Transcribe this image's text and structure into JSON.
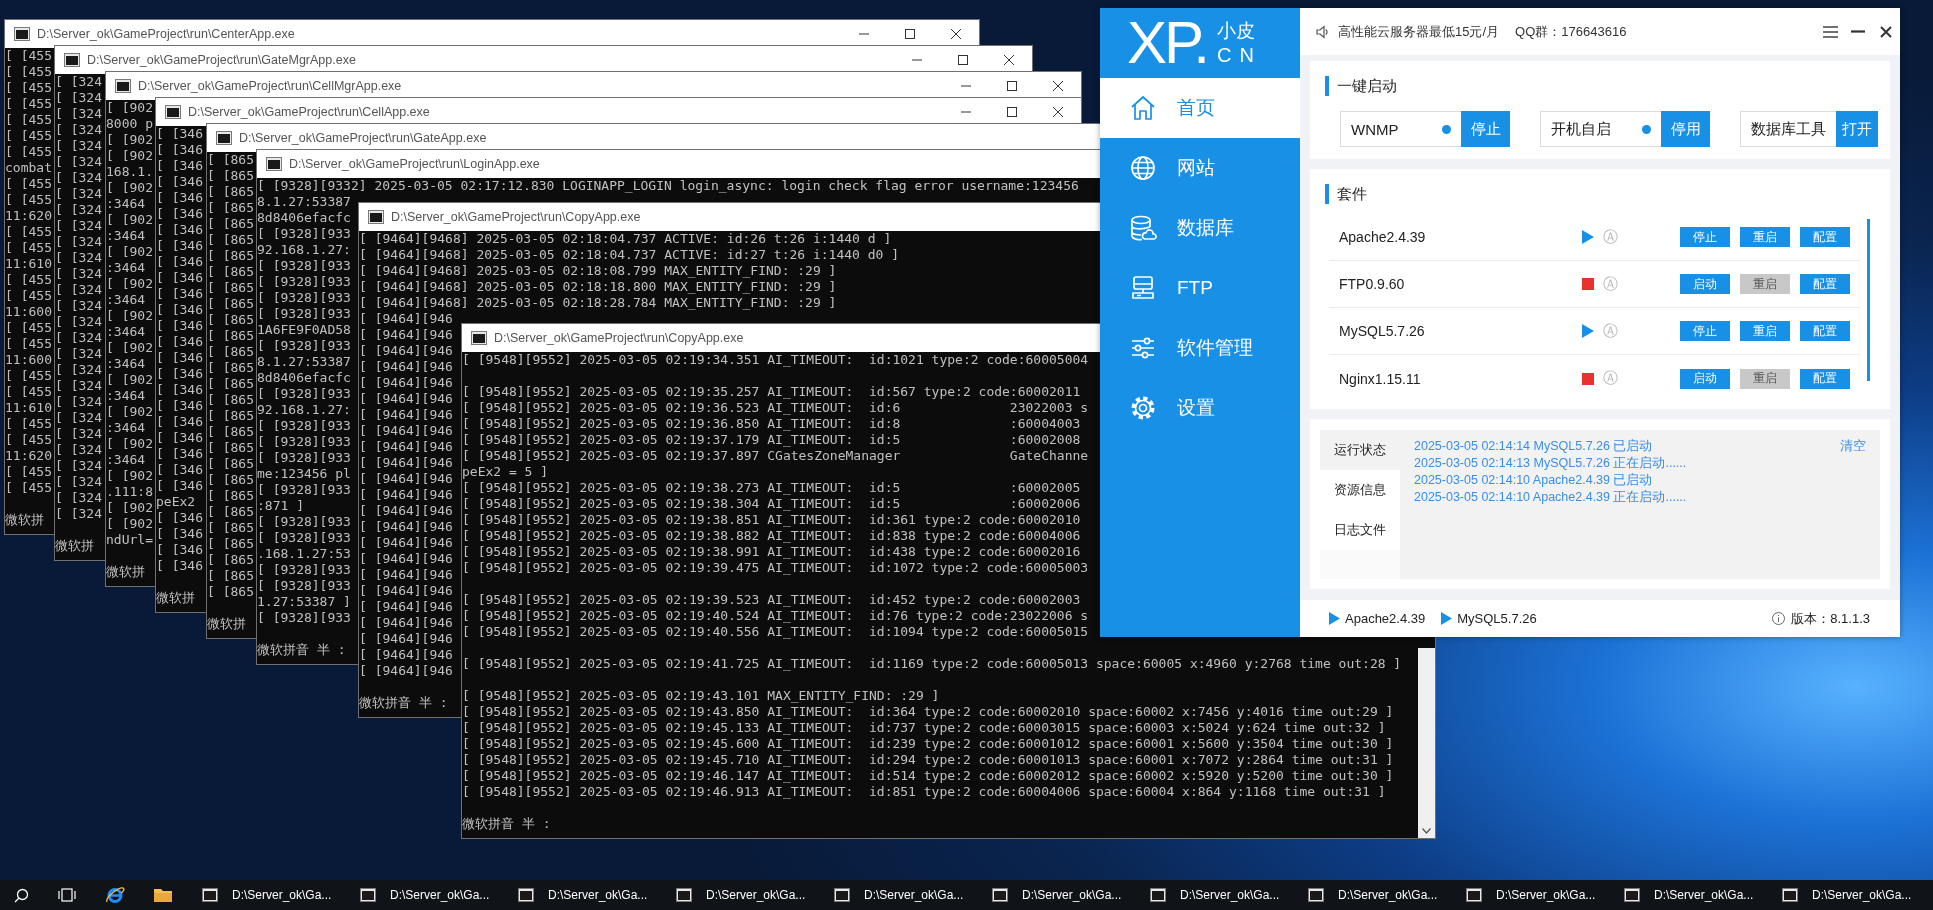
{
  "console_windows": [
    {
      "title": "D:\\Server_ok\\GameProject\\run\\CenterApp.exe",
      "controls": true,
      "blocks": [
        [
          "[ [455",
          "[ [455",
          "[ [455",
          "[ [455",
          "[ [455",
          "[ [455",
          "[ [455",
          "combat",
          "[ [455",
          "[ [455",
          "11:620",
          "[ [455",
          "[ [455",
          "11:610",
          "[ [455",
          "[ [455",
          "11:600",
          "[ [455",
          "[ [455",
          "11:600",
          "[ [455",
          "[ [455",
          "11:610",
          "[ [455",
          "[ [455",
          "11:620",
          "[ [455",
          "[ [455"
        ]
      ],
      "ime_status": "微软拼"
    },
    {
      "title": "D:\\Server_ok\\GameProject\\run\\GateMgrApp.exe",
      "controls": true,
      "blocks": [
        [
          "[ [324",
          "[ [324",
          "[ [324",
          "[ [324",
          "[ [324",
          "[ [324",
          "[ [324",
          "[ [324",
          "[ [324",
          "[ [324",
          "[ [324",
          "[ [324",
          "[ [324",
          "[ [324",
          "[ [324",
          "[ [324",
          "[ [324",
          "[ [324",
          "[ [324",
          "[ [324",
          "[ [324",
          "[ [324",
          "[ [324",
          "[ [324",
          "[ [324",
          "[ [324",
          "[ [324",
          "[ [324"
        ]
      ],
      "ime_status": "微软拼"
    },
    {
      "title": "D:\\Server_ok\\GameProject\\run\\CellMgrApp.exe",
      "controls": true,
      "blocks": [
        [
          "[ [902",
          "8000 p",
          "[ [902",
          "[ [902",
          "168.1.",
          "[ [902",
          ":3464",
          "[ [902",
          ":3464",
          "[ [902",
          ":3464",
          "[ [902",
          ":3464",
          "[ [902",
          ":3464",
          "[ [902",
          ":3464",
          "[ [902",
          ":3464",
          "[ [902",
          ":3464",
          "[ [902",
          ":3464",
          "[ [902",
          ".111:8",
          "[ [902",
          "[ [902",
          "ndUrl="
        ]
      ],
      "ime_status": "微软拼"
    },
    {
      "title": "D:\\Server_ok\\GameProject\\run\\CellApp.exe",
      "controls": true,
      "blocks": [
        [
          "[ [346",
          "[ [346",
          "[ [346",
          "[ [346",
          "[ [346",
          "[ [346",
          "[ [346",
          "[ [346",
          "[ [346",
          "[ [346",
          "[ [346",
          "[ [346",
          "[ [346",
          "[ [346",
          "[ [346",
          "[ [346",
          "[ [346",
          "[ [346",
          "[ [346",
          "[ [346",
          "[ [346",
          "[ [346",
          "[ [346",
          "peEx2",
          "[ [346",
          "[ [346",
          "[ [346",
          "[ [346"
        ]
      ],
      "ime_status": "微软拼"
    },
    {
      "title": "D:\\Server_ok\\GameProject\\run\\GateApp.exe",
      "blocks": [
        [
          "[ [865",
          "[ [865",
          "[ [865",
          "[ [865",
          "[ [865",
          "[ [865",
          "[ [865",
          "[ [865",
          "[ [865",
          "[ [865",
          "[ [865",
          "[ [865",
          "[ [865",
          "[ [865",
          "[ [865",
          "[ [865",
          "[ [865",
          "[ [865",
          "[ [865",
          "[ [865",
          "[ [865",
          "[ [865",
          "[ [865",
          "[ [865",
          "[ [865",
          "[ [865",
          "[ [865",
          "[ [865"
        ]
      ],
      "ime_status": "微软拼"
    },
    {
      "title": "D:\\Server_ok\\GameProject\\run\\LoginApp.exe",
      "blocks": [
        [
          "[ [9328][9332] 2025-03-05 02:17:12.830 LOGINAPP_LOGIN login_async: login check flag error username:123456",
          "8.1.27:53387",
          "8d8406efacfc",
          "[ [9328][933",
          "92.168.1.27:",
          "[ [9328][933",
          "[ [9328][933",
          "[ [9328][933",
          "[ [9328][933",
          "1A6FE9F0AD58",
          "[ [9328][933",
          "8.1.27:53387",
          "8d8406efacfc",
          "[ [9328][933",
          "92.168.1.27:",
          "[ [9328][933",
          "[ [9328][933",
          "[ [9328][933",
          "me:123456 pl",
          "[ [9328][933",
          ":871 ]",
          "[ [9328][933",
          "[ [9328][933",
          ".168.1.27:53",
          "[ [9328][933",
          "[ [9328][933",
          "1.27:53387 ]",
          "[ [9328][933"
        ]
      ],
      "ime_status": "微软拼音 半 :"
    },
    {
      "title": "D:\\Server_ok\\GameProject\\run\\CopyApp.exe",
      "blocks": [
        [
          "[ [9464][9468] 2025-03-05 02:18:04.737 ACTIVE: id:26 t:26 i:1440 d ]",
          "[ [9464][9468] 2025-03-05 02:18:04.737 ACTIVE: id:27 t:26 i:1440 d0 ]",
          "[ [9464][9468] 2025-03-05 02:18:08.799 MAX_ENTITY_FIND: :29 ]",
          "[ [9464][9468] 2025-03-05 02:18:18.800 MAX_ENTITY_FIND: :29 ]",
          "[ [9464][9468] 2025-03-05 02:18:28.784 MAX_ENTITY_FIND: :29 ]",
          "[ [9464][946",
          "[ [9464][946",
          "[ [9464][946",
          "[ [9464][946",
          "[ [9464][946",
          "[ [9464][946",
          "[ [9464][946",
          "[ [9464][946",
          "[ [9464][946",
          "[ [9464][946",
          "[ [9464][946",
          "[ [9464][946",
          "[ [9464][946",
          "[ [9464][946",
          "[ [9464][946",
          "[ [9464][946",
          "[ [9464][946",
          "[ [9464][946",
          "[ [9464][946",
          "[ [9464][946",
          "[ [9464][946",
          "[ [9464][946",
          "[ [9464][946"
        ]
      ],
      "ime_status": "微软拼音 半 :"
    },
    {
      "title": "D:\\Server_ok\\GameProject\\run\\CopyApp.exe",
      "blocks": [
        [
          "[ [9548][9552] 2025-03-05 02:19:34.351 AI_TIMEOUT:  id:1021 type:2 code:60005004"
        ],
        [
          "[ [9548][9552] 2025-03-05 02:19:35.257 AI_TIMEOUT:  id:567 type:2 code:60002011",
          "[ [9548][9552] 2025-03-05 02:19:36.523 AI_TIMEOUT:  id:6              23022003 s",
          "[ [9548][9552] 2025-03-05 02:19:36.850 AI_TIMEOUT:  id:8              :60004003",
          "[ [9548][9552] 2025-03-05 02:19:37.179 AI_TIMEOUT:  id:5              :60002008",
          "[ [9548][9552] 2025-03-05 02:19:37.897 CGatesZoneManager              GateChanne",
          "peEx2 = 5 ]",
          "[ [9548][9552] 2025-03-05 02:19:38.273 AI_TIMEOUT:  id:5              :60002005",
          "[ [9548][9552] 2025-03-05 02:19:38.304 AI_TIMEOUT:  id:5              :60002006",
          "[ [9548][9552] 2025-03-05 02:19:38.851 AI_TIMEOUT:  id:361 type:2 code:60002010",
          "[ [9548][9552] 2025-03-05 02:19:38.882 AI_TIMEOUT:  id:838 type:2 code:60004006",
          "[ [9548][9552] 2025-03-05 02:19:38.991 AI_TIMEOUT:  id:438 type:2 code:60002016",
          "[ [9548][9552] 2025-03-05 02:19:39.475 AI_TIMEOUT:  id:1072 type:2 code:60005003"
        ],
        [
          "[ [9548][9552] 2025-03-05 02:19:39.523 AI_TIMEOUT:  id:452 type:2 code:60002003",
          "[ [9548][9552] 2025-03-05 02:19:40.524 AI_TIMEOUT:  id:76 type:2 code:23022006 s",
          "[ [9548][9552] 2025-03-05 02:19:40.556 AI_TIMEOUT:  id:1094 type:2 code:60005015"
        ],
        [
          "[ [9548][9552] 2025-03-05 02:19:41.725 AI_TIMEOUT:  id:1169 type:2 code:60005013 space:60005 x:4960 y:2768 time out:28 ]"
        ],
        [
          "[ [9548][9552] 2025-03-05 02:19:43.101 MAX_ENTITY_FIND: :29 ]",
          "[ [9548][9552] 2025-03-05 02:19:43.850 AI_TIMEOUT:  id:364 type:2 code:60002010 space:60002 x:7456 y:4016 time out:29 ]",
          "[ [9548][9552] 2025-03-05 02:19:45.133 AI_TIMEOUT:  id:737 type:2 code:60003015 space:60003 x:5024 y:624 time out:32 ]",
          "[ [9548][9552] 2025-03-05 02:19:45.600 AI_TIMEOUT:  id:239 type:2 code:60001012 space:60001 x:5600 y:3504 time out:30 ]",
          "[ [9548][9552] 2025-03-05 02:19:45.710 AI_TIMEOUT:  id:294 type:2 code:60001013 space:60001 x:7072 y:2864 time out:31 ]",
          "[ [9548][9552] 2025-03-05 02:19:46.147 AI_TIMEOUT:  id:514 type:2 code:60002012 space:60002 x:5920 y:5200 time out:30 ]",
          "[ [9548][9552] 2025-03-05 02:19:46.913 AI_TIMEOUT:  id:851 type:2 code:60004006 space:60004 x:864 y:1168 time out:31 ]"
        ]
      ],
      "ime_status": "微软拼音 半 :"
    }
  ],
  "xp_panel": {
    "logo": {
      "mark": "XP.",
      "name": "小皮",
      "domain": "CN"
    },
    "nav": [
      {
        "label": "首页",
        "selected": true
      },
      {
        "label": "网站",
        "selected": false
      },
      {
        "label": "数据库",
        "selected": false
      },
      {
        "label": "FTP",
        "selected": false
      },
      {
        "label": "软件管理",
        "selected": false
      },
      {
        "label": "设置",
        "selected": false
      }
    ],
    "notice": "高性能云服务器最低15元/月",
    "qq": "QQ群：176643616",
    "quick_start": {
      "title": "一键启动",
      "items": [
        {
          "label": "WNMP",
          "status_dot": true,
          "button": "停止"
        },
        {
          "label": "开机自启",
          "status_dot": true,
          "button": "停用"
        },
        {
          "label": "数据库工具",
          "status_dot": false,
          "button": "打开"
        }
      ]
    },
    "suite": {
      "title": "套件",
      "rows": [
        {
          "name": "Apache2.4.39",
          "running": true,
          "auto_mark": "Ⓐ",
          "buttons": [
            {
              "label": "停止",
              "disabled": false
            },
            {
              "label": "重启",
              "disabled": false
            },
            {
              "label": "配置",
              "disabled": false
            }
          ]
        },
        {
          "name": "FTP0.9.60",
          "running": false,
          "auto_mark": "Ⓐ",
          "buttons": [
            {
              "label": "启动",
              "disabled": false
            },
            {
              "label": "重启",
              "disabled": true
            },
            {
              "label": "配置",
              "disabled": false
            }
          ]
        },
        {
          "name": "MySQL5.7.26",
          "running": true,
          "auto_mark": "Ⓐ",
          "buttons": [
            {
              "label": "停止",
              "disabled": false
            },
            {
              "label": "重启",
              "disabled": false
            },
            {
              "label": "配置",
              "disabled": false
            }
          ]
        },
        {
          "name": "Nginx1.15.11",
          "running": false,
          "auto_mark": "Ⓐ",
          "buttons": [
            {
              "label": "启动",
              "disabled": false
            },
            {
              "label": "重启",
              "disabled": true
            },
            {
              "label": "配置",
              "disabled": false
            }
          ]
        }
      ]
    },
    "log": {
      "tabs": [
        {
          "label": "运行状态",
          "selected": true
        },
        {
          "label": "资源信息",
          "selected": false
        },
        {
          "label": "日志文件",
          "selected": false
        }
      ],
      "lines": [
        "2025-03-05 02:14:14 MySQL5.7.26 已启动",
        "2025-03-05 02:14:13 MySQL5.7.26 正在启动......",
        "2025-03-05 02:14:10 Apache2.4.39 已启动",
        "2025-03-05 02:14:10 Apache2.4.39 正在启动......"
      ],
      "clear": "清空"
    },
    "footer": {
      "services": [
        "Apache2.4.39",
        "MySQL5.7.26"
      ],
      "version": "版本：8.1.1.3"
    }
  },
  "taskbar": {
    "items": [
      {
        "label": "D:\\Server_ok\\Ga..."
      },
      {
        "label": "D:\\Server_ok\\Ga..."
      },
      {
        "label": "D:\\Server_ok\\Ga..."
      },
      {
        "label": "D:\\Server_ok\\Ga..."
      },
      {
        "label": "D:\\Server_ok\\Ga..."
      },
      {
        "label": "D:\\Server_ok\\Ga..."
      },
      {
        "label": "D:\\Server_ok\\Ga..."
      },
      {
        "label": "D:\\Server_ok\\Ga..."
      },
      {
        "label": "D:\\Server_ok\\Ga..."
      },
      {
        "label": "D:\\Server_ok\\Ga..."
      },
      {
        "label": "D:\\Server_ok\\Ga..."
      }
    ]
  }
}
